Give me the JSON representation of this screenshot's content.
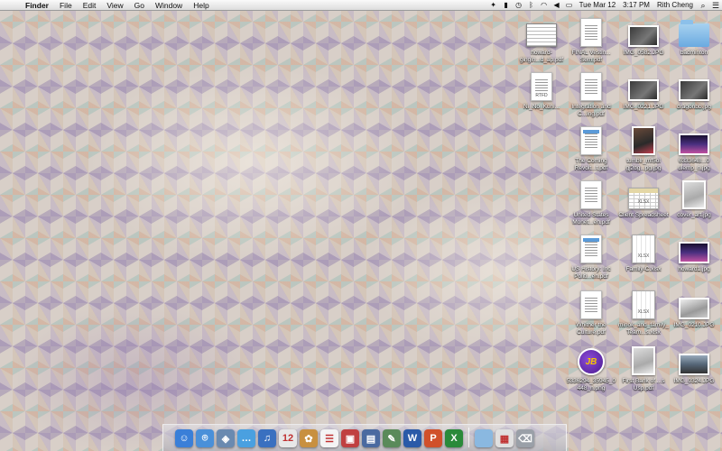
{
  "menubar": {
    "app_name": "Finder",
    "menus": [
      "File",
      "Edit",
      "View",
      "Go",
      "Window",
      "Help"
    ],
    "date": "Tue Mar 12",
    "time": "3:17 PM",
    "user": "Rith Cheng"
  },
  "desktop_icons": [
    {
      "label": "howard-gingin...d_ap.pdf",
      "kind": "screenshot"
    },
    {
      "label": "FINAL Vestin... Sem.pdf",
      "kind": "document"
    },
    {
      "label": "IMG_0582.JPG",
      "kind": "photo"
    },
    {
      "label": "badminton",
      "kind": "folder"
    },
    {
      "label": "Ni_No_Kuni...",
      "kind": "document",
      "tag": "RTFD"
    },
    {
      "label": "Integration and C...ing.pdf",
      "kind": "document"
    },
    {
      "label": "IMG_0221.JPG",
      "kind": "photo"
    },
    {
      "label": "dragonbb.jpg",
      "kind": "photo"
    },
    {
      "label": "The Coming Revolt...t.pdf",
      "kind": "document-blue"
    },
    {
      "label": "tumblr_mf5ol gj2dg...pg.jpg",
      "kind": "photo-tall"
    },
    {
      "label": "6333648...0 ulemp_n.jpg",
      "kind": "photo-stage"
    },
    {
      "label": "United States Monet...en.pdf",
      "kind": "document"
    },
    {
      "label": "Client Spreadsheet",
      "kind": "spreadsheet",
      "tag": "XLSX"
    },
    {
      "label": "cover_art.jpg",
      "kind": "photo-pale"
    },
    {
      "label": "US History: Inc Politi...en.pdf",
      "kind": "document-blue"
    },
    {
      "label": "Family-C.xlsx",
      "kind": "spreadsheet-tall",
      "tag": "XLSX"
    },
    {
      "label": "howard1.jpg",
      "kind": "photo-stage"
    },
    {
      "label": "Whither the Culture.pdf",
      "kind": "document"
    },
    {
      "label": "minok_and_family_Team...s.xlsx",
      "kind": "spreadsheet-tall",
      "tag": "XLSX"
    },
    {
      "label": "IMG_0210.JPG",
      "kind": "photo-grey"
    },
    {
      "label": "5336294_35945_0448_n.png",
      "kind": "logo",
      "tag": "JB"
    },
    {
      "label": "First Bank of ...s Usp.pdf",
      "kind": "photo-pale"
    },
    {
      "label": "IMG_0324.JPG",
      "kind": "photo-street"
    }
  ],
  "dock": {
    "icons": [
      {
        "name": "finder-icon",
        "glyph": "☺",
        "color": "#3a7fd8"
      },
      {
        "name": "safari-icon",
        "glyph": "⌾",
        "color": "#4a90d9"
      },
      {
        "name": "preview-icon",
        "glyph": "◈",
        "color": "#6a8ab0"
      },
      {
        "name": "messages-icon",
        "glyph": "…",
        "color": "#4aa0e0"
      },
      {
        "name": "itunes-icon",
        "glyph": "♫",
        "color": "#3a70c0"
      },
      {
        "name": "calendar-icon",
        "glyph": "12",
        "color": "#e8e8e8"
      },
      {
        "name": "iphoto-icon",
        "glyph": "✿",
        "color": "#c89040"
      },
      {
        "name": "reminders-icon",
        "glyph": "☰",
        "color": "#f4f4f4"
      },
      {
        "name": "photo-booth-icon",
        "glyph": "▣",
        "color": "#c04040"
      },
      {
        "name": "keynote-icon",
        "glyph": "▤",
        "color": "#4a6aa0"
      },
      {
        "name": "textedit-icon",
        "glyph": "✎",
        "color": "#5a8a5a"
      },
      {
        "name": "word-icon",
        "glyph": "W",
        "color": "#2a5aa8"
      },
      {
        "name": "powerpoint-icon",
        "glyph": "P",
        "color": "#d0502a"
      },
      {
        "name": "excel-icon",
        "glyph": "X",
        "color": "#2a8a3a"
      },
      {
        "name": "downloads-folder-icon",
        "glyph": "",
        "color": "#8ab8e0"
      },
      {
        "name": "documents-stack-icon",
        "glyph": "▦",
        "color": "#e0e0e0"
      },
      {
        "name": "trash-icon",
        "glyph": "⌫",
        "color": "#9aa0a8"
      }
    ]
  }
}
